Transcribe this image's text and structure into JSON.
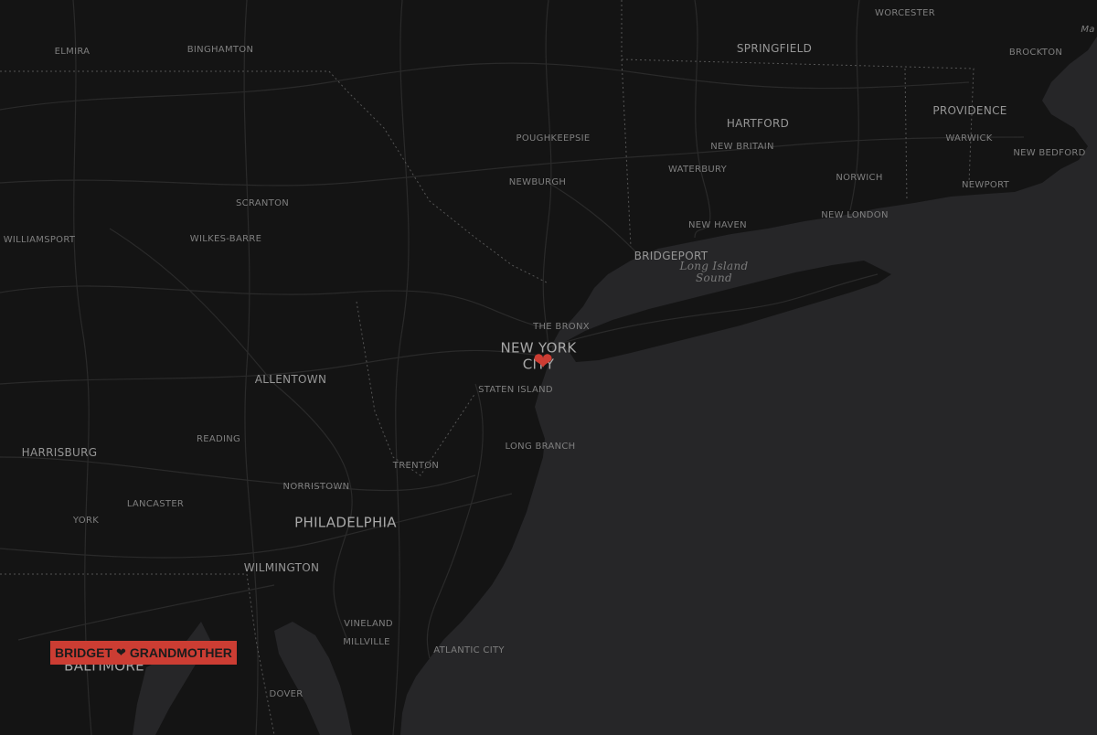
{
  "colors": {
    "land": "#141414",
    "water": "#262628",
    "roads": "#2a2a2a",
    "border": "#555555",
    "accent": "#cc3d33",
    "badge_text": "#1c1c1c"
  },
  "marker": {
    "icon": "heart-icon",
    "glyph": "❤"
  },
  "badge": {
    "left": "BRIDGET",
    "glyph": "❤",
    "right": "GRANDMOTHER"
  },
  "labels": {
    "elmira": "ELMIRA",
    "binghamton": "BINGHAMTON",
    "worcester": "WORCESTER",
    "ma": "Ma",
    "springfield": "SPRINGFIELD",
    "brockton": "BROCKTON",
    "hartford": "HARTFORD",
    "providence": "PROVIDENCE",
    "poughkeepsie": "POUGHKEEPSIE",
    "warwick": "WARWICK",
    "new_britain": "NEW BRITAIN",
    "new_bedford": "NEW BEDFORD",
    "waterbury": "WATERBURY",
    "norwich": "NORWICH",
    "newburgh": "NEWBURGH",
    "newport": "NEWPORT",
    "scranton": "SCRANTON",
    "new_london": "NEW LONDON",
    "new_haven": "NEW HAVEN",
    "williamsport": "WILLIAMSPORT",
    "wilkes_barre": "WILKES-BARRE",
    "bridgeport": "BRIDGEPORT",
    "long_island_sound_1": "Long Island",
    "long_island_sound_2": "Sound",
    "the_bronx": "THE BRONX",
    "new_york": "NEW YORK",
    "city": "CITY",
    "allentown": "ALLENTOWN",
    "staten_island": "STATEN ISLAND",
    "reading": "READING",
    "long_branch": "LONG BRANCH",
    "harrisburg": "HARRISBURG",
    "trenton": "TRENTON",
    "norristown": "NORRISTOWN",
    "lancaster": "LANCASTER",
    "york": "YORK",
    "philadelphia": "PHILADELPHIA",
    "wilmington": "WILMINGTON",
    "vineland": "VINELAND",
    "millville": "MILLVILLE",
    "atlantic_city": "ATLANTIC CITY",
    "baltimore": "BALTIMORE",
    "dover": "DOVER"
  }
}
